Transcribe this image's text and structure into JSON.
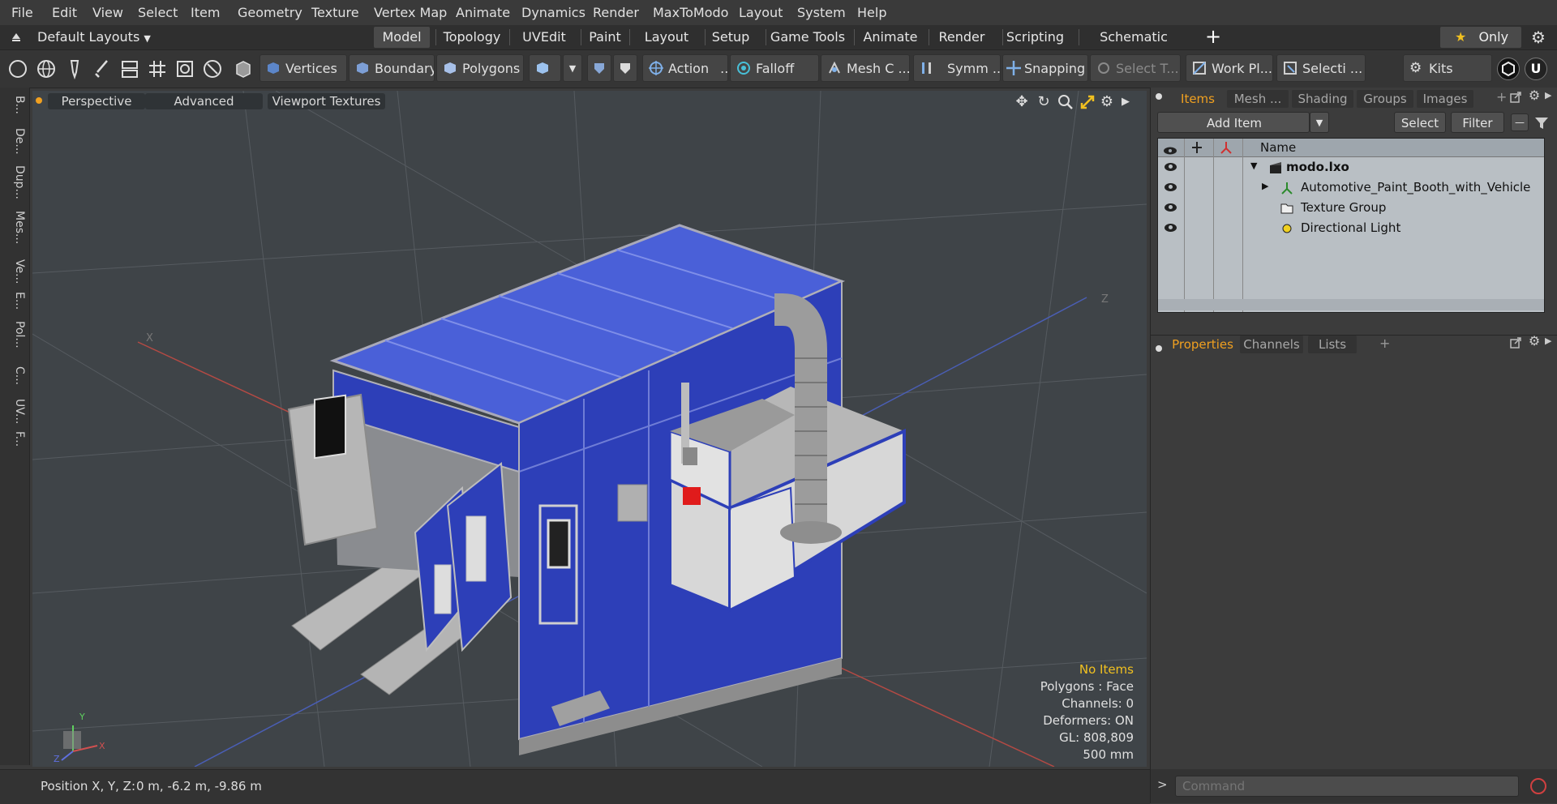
{
  "menubar": {
    "items": [
      "File",
      "Edit",
      "View",
      "Select",
      "Item",
      "Geometry",
      "Texture",
      "Vertex Map",
      "Animate",
      "Dynamics",
      "Render",
      "MaxToModo",
      "Layout",
      "System",
      "Help"
    ]
  },
  "layoutbar": {
    "layout_selector": "Default Layouts",
    "tabs": [
      "Model",
      "Topology",
      "UVEdit",
      "Paint",
      "Layout",
      "Setup",
      "Game Tools",
      "Animate",
      "Render",
      "Scripting",
      "Schematic Fusion"
    ],
    "active_tab": "Model",
    "only_label": "Only"
  },
  "toolbar": {
    "vertices": "Vertices",
    "boundary": "Boundary",
    "polygons": "Polygons",
    "action": "Action",
    "falloff": "Falloff",
    "mesh_c": "Mesh C ...",
    "symm": "Symm ...",
    "snapping": "Snapping",
    "select_t": "Select T...",
    "work_pl": "Work Pl...",
    "selecti": "Selecti ...",
    "kits": "Kits"
  },
  "left_tabs": [
    "B...",
    "De...",
    "Dup...",
    "Mes...",
    "Ve...",
    "E...",
    "Pol...",
    "C...",
    "UV...",
    "F..."
  ],
  "viewport": {
    "perspective": "Perspective",
    "advanced": "Advanced",
    "viewport_textures": "Viewport Textures",
    "info": {
      "no_items": "No Items",
      "polygons": "Polygons : Face",
      "channels": "Channels: 0",
      "deformers": "Deformers: ON",
      "gl": "GL: 808,809",
      "scale": "500 mm"
    },
    "axis_labels": {
      "y": "Y",
      "x": "X",
      "z": "Z"
    }
  },
  "statusbar": {
    "position_label": "Position X, Y, Z:",
    "position_value": "0 m, -6.2 m, -9.86 m"
  },
  "items_panel": {
    "tabs": [
      "Items",
      "Mesh ...",
      "Shading",
      "Groups",
      "Images"
    ],
    "active_tab": "Items",
    "add_item": "Add Item",
    "select": "Select",
    "filter": "Filter",
    "column_name": "Name",
    "rows": [
      {
        "label": "modo.lxo",
        "bold": true
      },
      {
        "label": "Automotive_Paint_Booth_with_Vehicle",
        "bold": false
      },
      {
        "label": "Texture Group",
        "bold": false
      },
      {
        "label": "Directional Light",
        "bold": false
      }
    ]
  },
  "properties_panel": {
    "tabs": [
      "Properties",
      "Channels",
      "Lists"
    ],
    "active_tab": "Properties"
  },
  "command": {
    "placeholder": "Command"
  },
  "colors": {
    "accent": "#f0a020",
    "booth_blue": "#3446c4",
    "viewport_bg": "#3f4448"
  }
}
